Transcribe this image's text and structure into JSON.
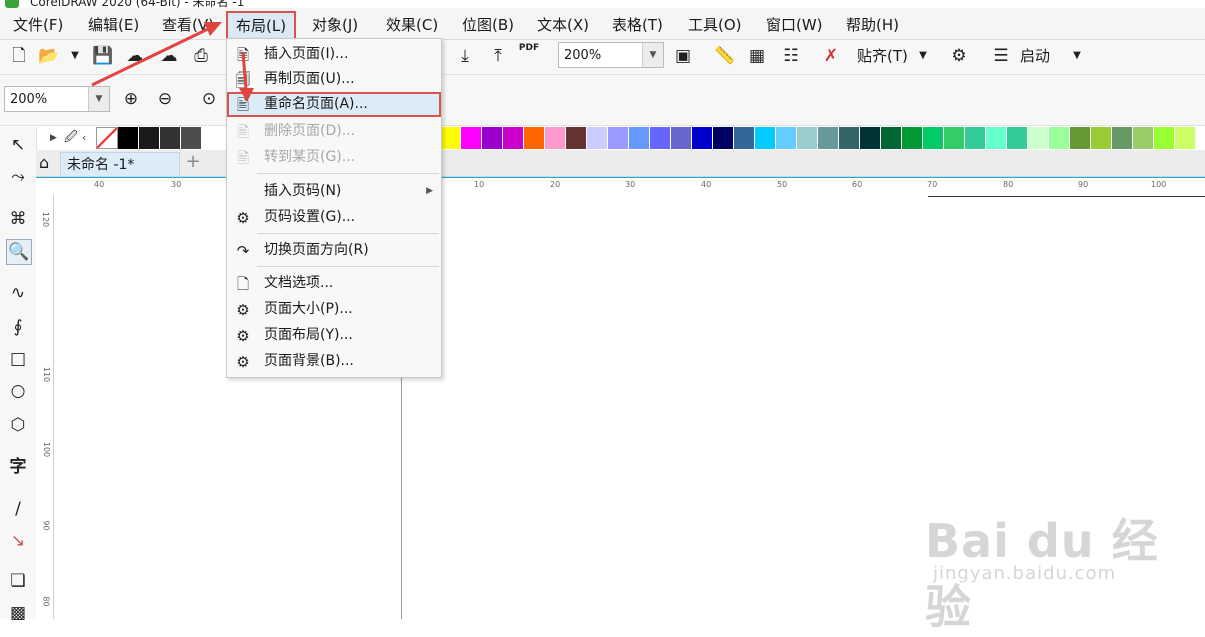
{
  "window": {
    "title": "CorelDRAW 2020 (64-Bit) - 未命名 -1"
  },
  "menubar": {
    "items": [
      "文件(F)",
      "编辑(E)",
      "查看(V)",
      "布局(L)",
      "对象(J)",
      "效果(C)",
      "位图(B)",
      "文本(X)",
      "表格(T)",
      "工具(O)",
      "窗口(W)",
      "帮助(H)"
    ]
  },
  "toolbar": {
    "zoom_value": "200%",
    "snap_label": "贴齐(T)",
    "launch_label": "启动",
    "pdf_label": "PDF"
  },
  "propertybar": {
    "zoom_value": "200%"
  },
  "document": {
    "tab_label": "未命名 -1*"
  },
  "ruler": {
    "h_ticks": [
      "40",
      "30",
      "10",
      "10",
      "20",
      "30",
      "40",
      "50",
      "60",
      "70",
      "80",
      "90",
      "100"
    ],
    "v_ticks": [
      "120",
      "110",
      "100",
      "90",
      "80"
    ]
  },
  "layout_menu": {
    "items": [
      {
        "label": "插入页面(I)...",
        "icon": "insert-page-icon",
        "state": "normal"
      },
      {
        "label": "再制页面(U)...",
        "icon": "duplicate-page-icon",
        "state": "normal"
      },
      {
        "label": "重命名页面(A)...",
        "icon": "rename-page-icon",
        "state": "highlighted"
      },
      {
        "label": "删除页面(D)...",
        "icon": "delete-page-icon",
        "state": "disabled"
      },
      {
        "label": "转到某页(G)...",
        "icon": "goto-page-icon",
        "state": "disabled"
      },
      {
        "label": "插入页码(N)",
        "icon": "",
        "state": "submenu"
      },
      {
        "label": "页码设置(G)...",
        "icon": "page-number-settings-icon",
        "state": "normal"
      },
      {
        "label": "切换页面方向(R)",
        "icon": "switch-orientation-icon",
        "state": "normal"
      },
      {
        "label": "文档选项...",
        "icon": "document-options-icon",
        "state": "normal"
      },
      {
        "label": "页面大小(P)...",
        "icon": "page-size-icon",
        "state": "normal"
      },
      {
        "label": "页面布局(Y)...",
        "icon": "page-layout-icon",
        "state": "normal"
      },
      {
        "label": "页面背景(B)...",
        "icon": "page-background-icon",
        "state": "normal"
      }
    ]
  },
  "palette_colors": [
    "#ffffff",
    "#000000",
    "#1a1a1a",
    "#333333",
    "#4d4d4d",
    "#ffff00",
    "#ff00ff",
    "#9900cc",
    "#cc00cc",
    "#ff6600",
    "#ff99cc",
    "#663333",
    "#ccccff",
    "#9999ff",
    "#6699ff",
    "#6666ff",
    "#6666cc",
    "#0000cc",
    "#000066",
    "#336699",
    "#00ccff",
    "#66ccff",
    "#99cccc",
    "#669999",
    "#336666",
    "#003333",
    "#006633",
    "#009933",
    "#00cc66",
    "#33cc66",
    "#33cc99",
    "#66ffcc",
    "#33cc99",
    "#ccffcc",
    "#99ff99",
    "#669933",
    "#99cc33",
    "#669966",
    "#99cc66",
    "#99ff33",
    "#ccff66"
  ],
  "watermark": {
    "brand": "Bai du 经验",
    "url": "jingyan.baidu.com"
  },
  "colors": {
    "highlight_border": "#d9534f",
    "menu_hover": "#dcebf8",
    "ruler_accent": "#22a9d6"
  }
}
